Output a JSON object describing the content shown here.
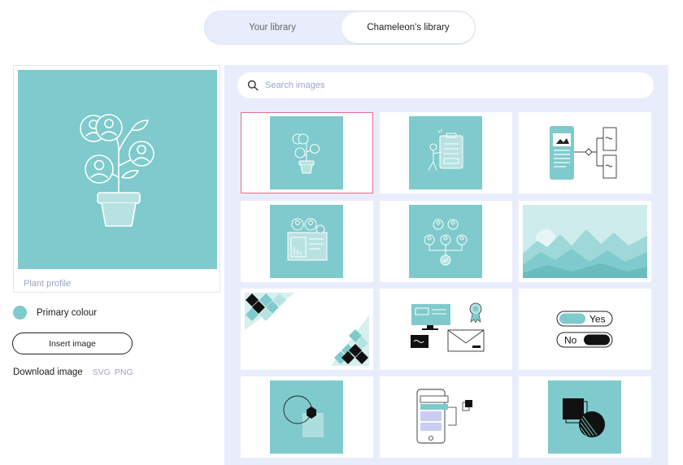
{
  "tabs": [
    {
      "label": "Your library"
    },
    {
      "label": "Chameleon's library"
    }
  ],
  "preview": {
    "image_name": "Plant profile",
    "colour_label": "Primary colour",
    "insert_label": "Insert image",
    "download_label": "Download image",
    "formats": [
      "SVG",
      "PNG"
    ]
  },
  "search": {
    "placeholder": "Search images"
  },
  "colors": {
    "primary": "#7fcacc",
    "panel": "#e9edfb",
    "selection": "#e46f8c",
    "muted_text": "#9aa6c6"
  },
  "library_items": [
    {
      "icon": "plant-profile-icon",
      "selected": true
    },
    {
      "icon": "clipboard-person-icon",
      "selected": false
    },
    {
      "icon": "mobile-flowchart-icon",
      "selected": false
    },
    {
      "icon": "team-dashboard-icon",
      "selected": false
    },
    {
      "icon": "org-chart-icon",
      "selected": false
    },
    {
      "icon": "mountain-landscape-icon",
      "selected": false
    },
    {
      "icon": "diamond-pattern-icon",
      "selected": false
    },
    {
      "icon": "devices-mail-icon",
      "selected": false
    },
    {
      "icon": "yes-no-toggle-icon",
      "selected": false,
      "labels": [
        "Yes",
        "No"
      ]
    },
    {
      "icon": "geometric-shapes-icon",
      "selected": false
    },
    {
      "icon": "mobile-layout-icon",
      "selected": false
    },
    {
      "icon": "square-circle-icon",
      "selected": false
    }
  ]
}
